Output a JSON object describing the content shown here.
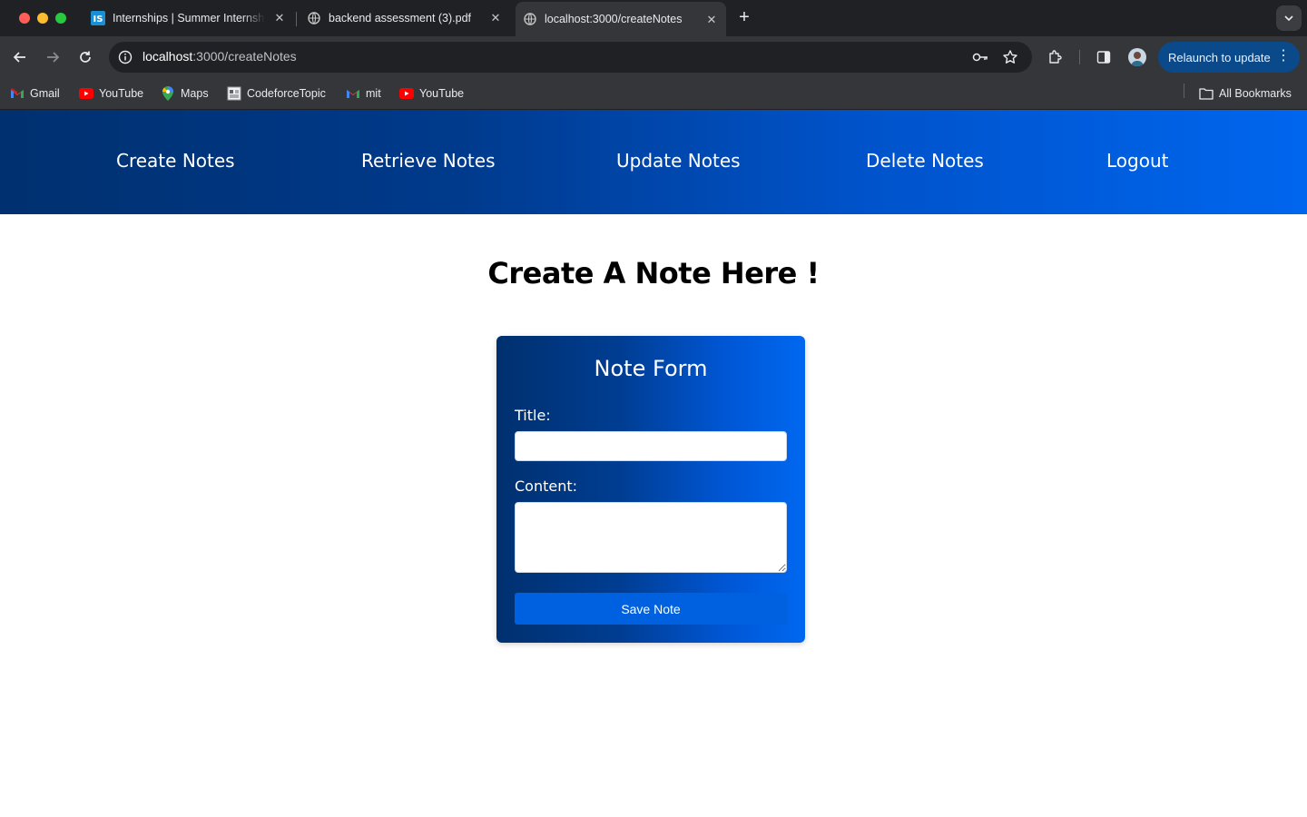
{
  "browser": {
    "tabs": [
      {
        "title": "Internships | Summer Internships",
        "favicon": "internshala-icon",
        "active": false
      },
      {
        "title": "backend assessment (3).pdf",
        "favicon": "globe-icon",
        "active": false
      },
      {
        "title": "localhost:3000/createNotes",
        "favicon": "globe-icon",
        "active": true
      }
    ],
    "address": {
      "host": "localhost",
      "path": ":3000/createNotes"
    },
    "relaunch_label": "Relaunch to update",
    "bookmarks": [
      {
        "label": "Gmail",
        "icon": "gmail-icon"
      },
      {
        "label": "YouTube",
        "icon": "youtube-icon"
      },
      {
        "label": "Maps",
        "icon": "maps-icon"
      },
      {
        "label": "CodeforceTopic",
        "icon": "page-icon"
      },
      {
        "label": "mit",
        "icon": "gmail-icon"
      },
      {
        "label": "YouTube",
        "icon": "youtube-icon"
      }
    ],
    "all_bookmarks_label": "All Bookmarks"
  },
  "navbar": {
    "links": [
      "Create Notes",
      "Retrieve Notes",
      "Update Notes",
      "Delete Notes",
      "Logout"
    ]
  },
  "page": {
    "title": "Create A Note Here !"
  },
  "form": {
    "heading": "Note Form",
    "title_label": "Title:",
    "title_value": "",
    "content_label": "Content:",
    "content_value": "",
    "submit_label": "Save Note"
  },
  "colors": {
    "brand_dark": "#00306f",
    "brand_light": "#0066ee",
    "button": "#0061e0"
  }
}
